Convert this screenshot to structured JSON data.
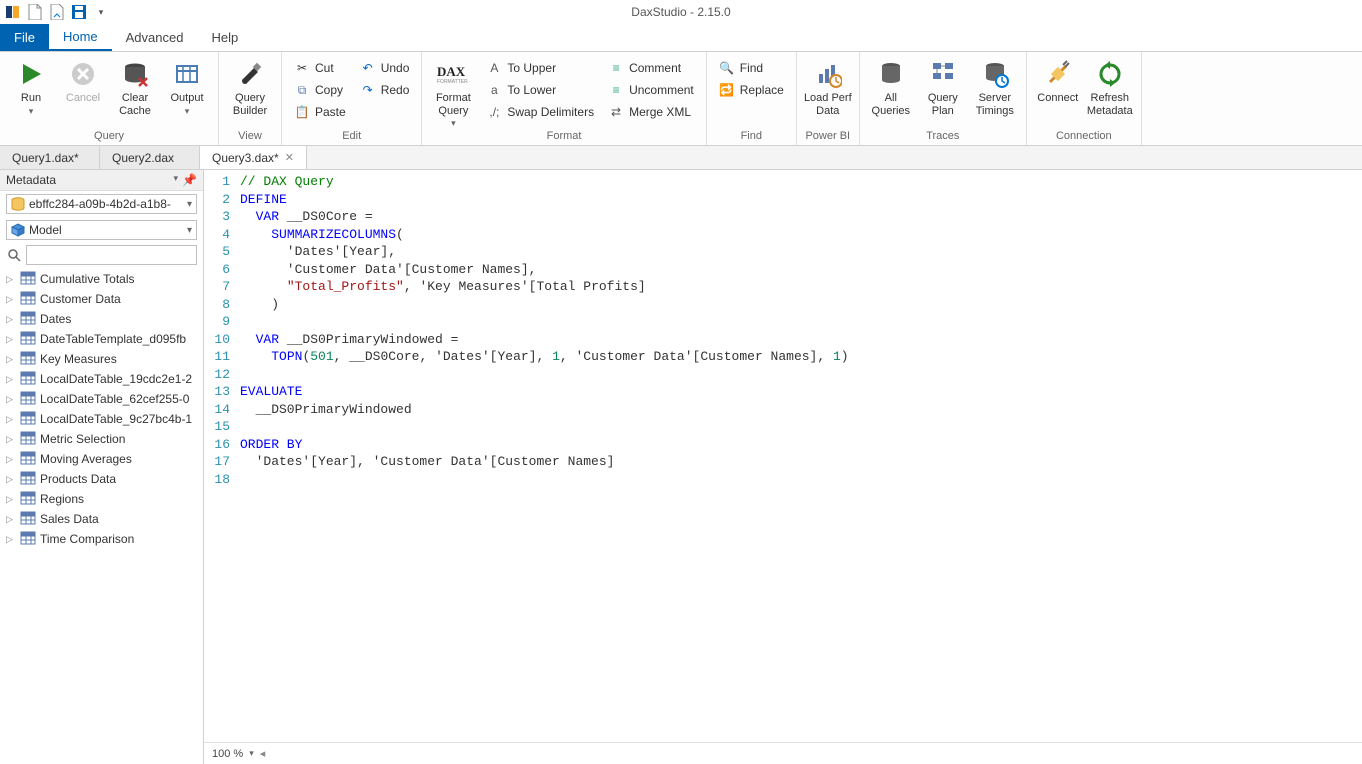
{
  "app": {
    "title": "DaxStudio - 2.15.0"
  },
  "qat": {
    "items": [
      "app-icon",
      "new-icon",
      "open-icon",
      "save-icon",
      "dropdown-icon"
    ]
  },
  "ribbonTabs": {
    "file": "File",
    "items": [
      "Home",
      "Advanced",
      "Help"
    ],
    "activeIndex": 0
  },
  "ribbon": {
    "groups": [
      {
        "label": "Query",
        "big": [
          {
            "name": "run",
            "label": "Run",
            "dd": true,
            "color": "green"
          },
          {
            "name": "cancel",
            "label": "Cancel",
            "disabled": true
          },
          {
            "name": "clear-cache",
            "label": "Clear\nCache"
          },
          {
            "name": "output",
            "label": "Output",
            "dd": true
          }
        ]
      },
      {
        "label": "View",
        "big": [
          {
            "name": "query-builder",
            "label": "Query\nBuilder"
          }
        ]
      },
      {
        "label": "Edit",
        "small": [
          {
            "name": "cut",
            "label": "Cut",
            "icon": "✂",
            "color": "#333"
          },
          {
            "name": "copy",
            "label": "Copy",
            "icon": "⧉",
            "color": "#5b7bb0"
          },
          {
            "name": "paste",
            "label": "Paste",
            "icon": "📋",
            "color": "#d08828"
          }
        ],
        "small2": [
          {
            "name": "undo",
            "label": "Undo",
            "icon": "↶",
            "color": "#0066cc"
          },
          {
            "name": "redo",
            "label": "Redo",
            "icon": "↷",
            "color": "#0066cc"
          }
        ]
      },
      {
        "label": "Format",
        "big": [
          {
            "name": "format-query",
            "label": "Format\nQuery",
            "dd": true,
            "text": "DAX"
          }
        ],
        "small": [
          {
            "name": "to-upper",
            "label": "To Upper",
            "icon": "A",
            "color": "#555"
          },
          {
            "name": "to-lower",
            "label": "To Lower",
            "icon": "a",
            "color": "#555"
          },
          {
            "name": "swap-delim",
            "label": "Swap Delimiters",
            "icon": ",/;",
            "color": "#555"
          }
        ],
        "small2": [
          {
            "name": "comment",
            "label": "Comment",
            "icon": "≡",
            "color": "#3a8"
          },
          {
            "name": "uncomment",
            "label": "Uncomment",
            "icon": "≡",
            "color": "#3a8"
          },
          {
            "name": "merge-xml",
            "label": "Merge XML",
            "icon": "⇄",
            "color": "#555"
          }
        ]
      },
      {
        "label": "Find",
        "small": [
          {
            "name": "find",
            "label": "Find",
            "icon": "🔍",
            "color": "#333"
          },
          {
            "name": "replace",
            "label": "Replace",
            "icon": "🔁",
            "color": "#333"
          }
        ]
      },
      {
        "label": "Power BI",
        "big": [
          {
            "name": "load-perf",
            "label": "Load Perf\nData"
          }
        ]
      },
      {
        "label": "Traces",
        "big": [
          {
            "name": "all-queries",
            "label": "All\nQueries"
          },
          {
            "name": "query-plan",
            "label": "Query\nPlan"
          },
          {
            "name": "server-timings",
            "label": "Server\nTimings"
          }
        ]
      },
      {
        "label": "Connection",
        "big": [
          {
            "name": "connect",
            "label": "Connect"
          },
          {
            "name": "refresh-meta",
            "label": "Refresh\nMetadata"
          }
        ]
      }
    ]
  },
  "docTabs": {
    "items": [
      {
        "label": "Query1.dax*",
        "active": false
      },
      {
        "label": "Query2.dax",
        "active": false
      },
      {
        "label": "Query3.dax*",
        "active": true
      }
    ]
  },
  "metadata": {
    "panelTitle": "Metadata",
    "database": "ebffc284-a09b-4b2d-a1b8-",
    "model": "Model",
    "tables": [
      "Cumulative Totals",
      "Customer Data",
      "Dates",
      "DateTableTemplate_d095fb",
      "Key Measures",
      "LocalDateTable_19cdc2e1-2",
      "LocalDateTable_62cef255-0",
      "LocalDateTable_9c27bc4b-1",
      "Metric Selection",
      "Moving Averages",
      "Products Data",
      "Regions",
      "Sales Data",
      "Time Comparison"
    ]
  },
  "editor": {
    "lines": [
      {
        "n": 1,
        "t": [
          {
            "c": "c-comment",
            "s": "// DAX Query"
          }
        ]
      },
      {
        "n": 2,
        "t": [
          {
            "c": "c-keyword",
            "s": "DEFINE"
          }
        ]
      },
      {
        "n": 3,
        "t": [
          {
            "c": "",
            "s": "  "
          },
          {
            "c": "c-keyword",
            "s": "VAR"
          },
          {
            "c": "",
            "s": " __DS0Core ="
          }
        ]
      },
      {
        "n": 4,
        "t": [
          {
            "c": "",
            "s": "    "
          },
          {
            "c": "c-func",
            "s": "SUMMARIZECOLUMNS"
          },
          {
            "c": "",
            "s": "("
          }
        ]
      },
      {
        "n": 5,
        "t": [
          {
            "c": "",
            "s": "      'Dates'[Year],"
          }
        ]
      },
      {
        "n": 6,
        "t": [
          {
            "c": "",
            "s": "      'Customer Data'[Customer Names],"
          }
        ]
      },
      {
        "n": 7,
        "t": [
          {
            "c": "",
            "s": "      "
          },
          {
            "c": "c-string",
            "s": "\"Total_Profits\""
          },
          {
            "c": "",
            "s": ", 'Key Measures'[Total Profits]"
          }
        ]
      },
      {
        "n": 8,
        "t": [
          {
            "c": "",
            "s": "    )"
          }
        ]
      },
      {
        "n": 9,
        "t": [
          {
            "c": "",
            "s": ""
          }
        ]
      },
      {
        "n": 10,
        "t": [
          {
            "c": "",
            "s": "  "
          },
          {
            "c": "c-keyword",
            "s": "VAR"
          },
          {
            "c": "",
            "s": " __DS0PrimaryWindowed ="
          }
        ]
      },
      {
        "n": 11,
        "t": [
          {
            "c": "",
            "s": "    "
          },
          {
            "c": "c-func",
            "s": "TOPN"
          },
          {
            "c": "",
            "s": "("
          },
          {
            "c": "c-number",
            "s": "501"
          },
          {
            "c": "",
            "s": ", __DS0Core, 'Dates'[Year], "
          },
          {
            "c": "c-number",
            "s": "1"
          },
          {
            "c": "",
            "s": ", 'Customer Data'[Customer Names], "
          },
          {
            "c": "c-number",
            "s": "1"
          },
          {
            "c": "",
            "s": ")"
          }
        ]
      },
      {
        "n": 12,
        "t": [
          {
            "c": "",
            "s": ""
          }
        ]
      },
      {
        "n": 13,
        "t": [
          {
            "c": "c-keyword",
            "s": "EVALUATE"
          }
        ]
      },
      {
        "n": 14,
        "t": [
          {
            "c": "",
            "s": "  __DS0PrimaryWindowed"
          }
        ]
      },
      {
        "n": 15,
        "t": [
          {
            "c": "",
            "s": ""
          }
        ]
      },
      {
        "n": 16,
        "t": [
          {
            "c": "c-keyword",
            "s": "ORDER BY"
          }
        ]
      },
      {
        "n": 17,
        "t": [
          {
            "c": "",
            "s": "  'Dates'[Year], 'Customer Data'[Customer Names]"
          }
        ]
      },
      {
        "n": 18,
        "t": [
          {
            "c": "",
            "s": ""
          }
        ]
      }
    ]
  },
  "status": {
    "zoom": "100 %"
  }
}
